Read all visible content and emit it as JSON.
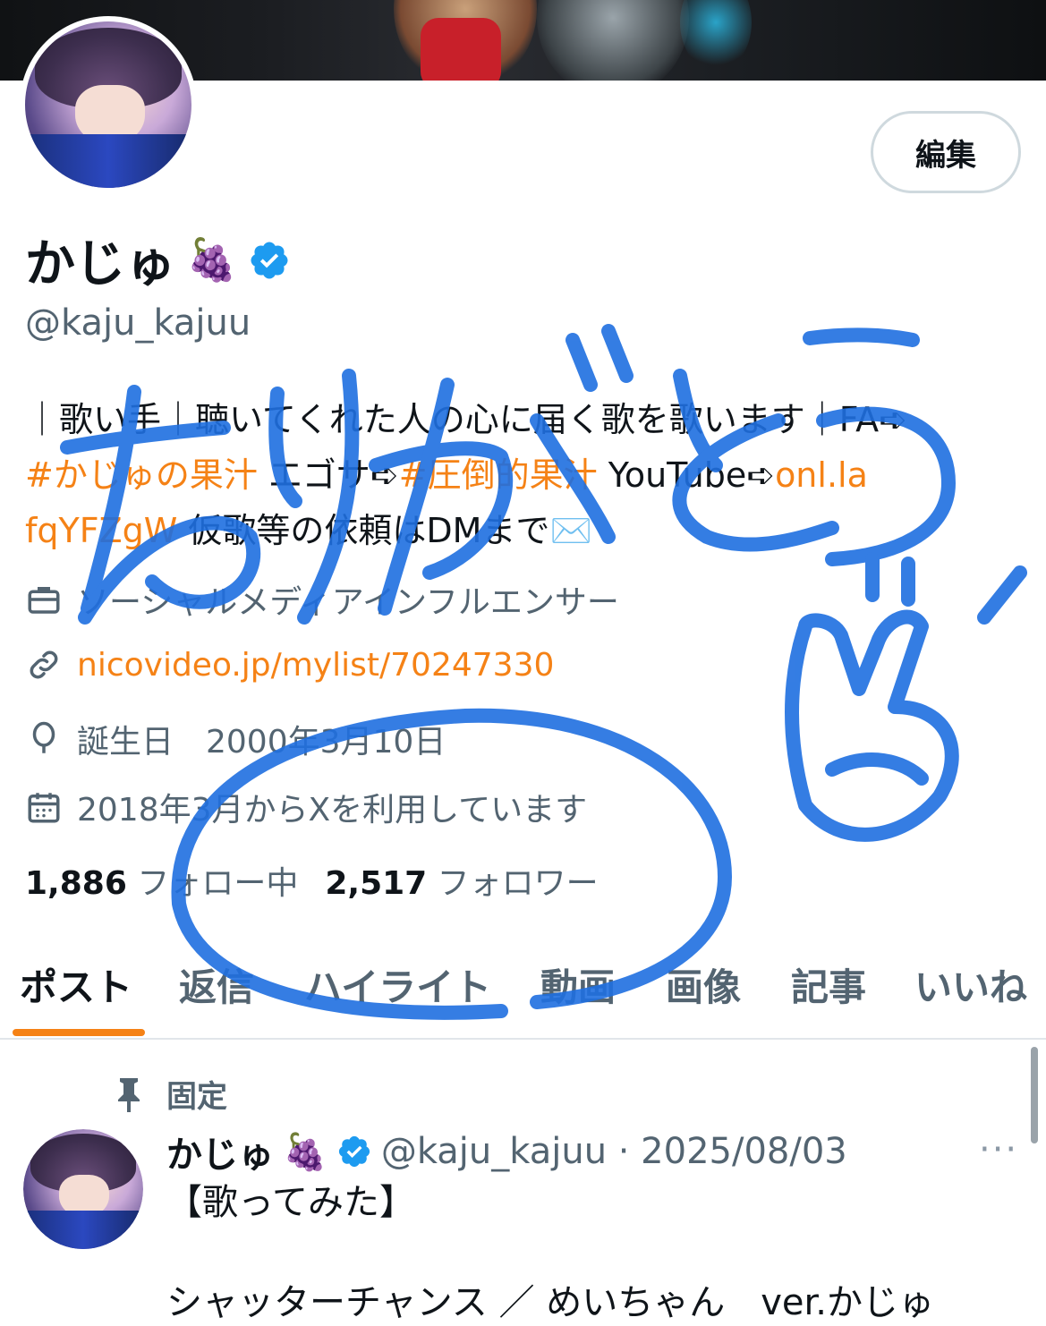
{
  "profile": {
    "edit_label": "編集",
    "name": "かじゅ",
    "name_emoji": "🍇",
    "handle": "@kaju_kajuu",
    "bio": {
      "line1": "｜歌い手｜聴いてくれた人の心に届く歌を歌います｜FA➪",
      "line2_tag": "#かじゅの果汁",
      "line2_mid": " エゴサ➪",
      "line2_tag2": "#圧倒的果汁",
      "line2_after": " YouTube➪",
      "line2_link": "onl.la",
      "line3_link": "fqYFZgW",
      "line3_text": " 仮歌等の依頼はDMまで",
      "line3_emoji": "✉️"
    },
    "category": "ソーシャルメディアインフルエンサー",
    "website": "nicovideo.jp/mylist/70247330",
    "birthday": "誕生日　2000年3月10日",
    "joined": "2018年3月からXを利用しています",
    "following_count": "1,886",
    "following_label": "フォロー中",
    "followers_count": "2,517",
    "followers_label": "フォロワー"
  },
  "tabs": [
    "ポスト",
    "返信",
    "ハイライト",
    "動画",
    "画像",
    "記事",
    "いいね"
  ],
  "post": {
    "pinned_label": "固定",
    "author_name": "かじゅ",
    "author_emoji": "🍇",
    "author_meta": "@kaju_kajuu · 2025/08/03",
    "more": "···",
    "line1": "【歌ってみた】",
    "line2": "シャッターチャンス ／ めいちゃん　ver.かじゅ"
  },
  "colors": {
    "accent": "#f58216",
    "verified": "#1d9bf0",
    "scribble": "#1f6fe0"
  }
}
